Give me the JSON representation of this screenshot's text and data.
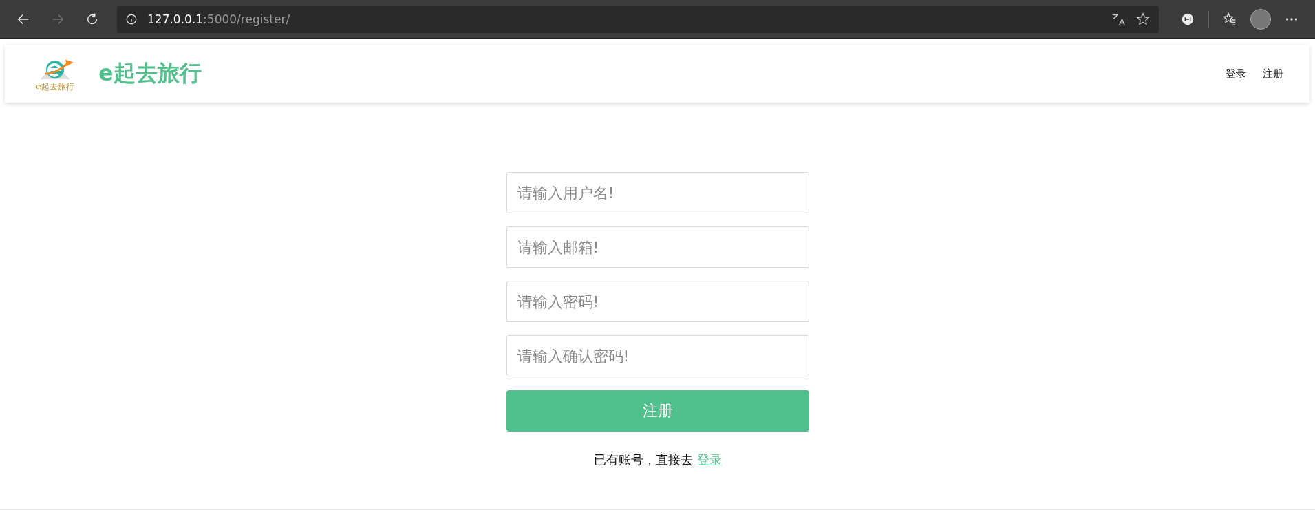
{
  "browser": {
    "back_disabled": false,
    "forward_disabled": true,
    "url": {
      "host": "127.0.0.1",
      "rest": ":5000/register/"
    }
  },
  "header": {
    "logo_caption": "e起去旅行",
    "brand": "e起去旅行",
    "nav": [
      {
        "label": "登录"
      },
      {
        "label": "注册"
      }
    ]
  },
  "form": {
    "fields": [
      {
        "placeholder": "请输入用户名!"
      },
      {
        "placeholder": "请输入邮箱!"
      },
      {
        "placeholder": "请输入密码!"
      },
      {
        "placeholder": "请输入确认密码!"
      }
    ],
    "submit": "注册",
    "footer_text": "已有账号，直接去",
    "footer_link": "登录"
  }
}
